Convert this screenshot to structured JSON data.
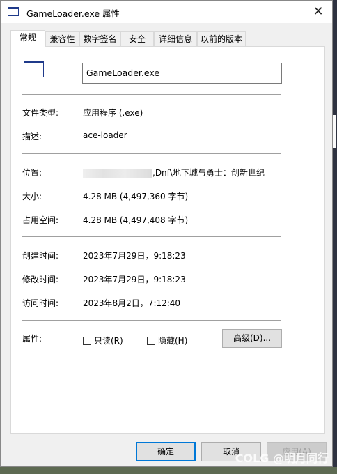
{
  "window": {
    "title": "GameLoader.exe 属性",
    "close_glyph": "✕"
  },
  "tabs": [
    "常规",
    "兼容性",
    "数字签名",
    "安全",
    "详细信息",
    "以前的版本"
  ],
  "general": {
    "file_name": "GameLoader.exe",
    "type_label": "文件类型:",
    "type_value": "应用程序 (.exe)",
    "desc_label": "描述:",
    "desc_value": "ace-loader",
    "location_label": "位置:",
    "location_value": ",Dnf\\地下城与勇士：创新世纪",
    "size_label": "大小:",
    "size_value": "4.28 MB (4,497,360 字节)",
    "disk_label": "占用空间:",
    "disk_value": "4.28 MB (4,497,408 字节)",
    "created_label": "创建时间:",
    "created_value": "2023年7月29日，9:18:23",
    "modified_label": "修改时间:",
    "modified_value": "2023年7月29日，9:18:23",
    "accessed_label": "访问时间:",
    "accessed_value": "2023年8月2日，7:12:40",
    "attr_label": "属性:",
    "readonly_label": "只读(R)",
    "hidden_label": "隐藏(H)",
    "advanced_label": "高级(D)..."
  },
  "buttons": {
    "ok": "确定",
    "cancel": "取消",
    "apply": "应用(A)"
  },
  "watermark": "COLG @明月同行",
  "icons": {
    "window_icon": "app-window-icon",
    "file_icon": "exe-file-icon"
  }
}
